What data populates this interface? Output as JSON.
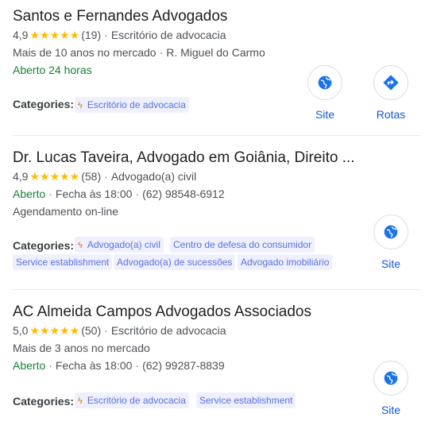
{
  "results": [
    {
      "name": "Santos e Fernandes Advogados",
      "rating": "4,9",
      "stars": "★★★★★",
      "reviews": "(19)",
      "type": "Escritório de advocacia",
      "line2a": "Mais de 10 anos no mercado",
      "line2b": "R. Miguel do Carmo",
      "status": "Aberto 24 horas",
      "categories_label": "Categories:",
      "chips": [
        "Escritório de advocacia"
      ],
      "site_label": "Site",
      "rotas_label": "Rotas"
    },
    {
      "name": "Dr. Lucas Taveira, Advogado em Goiânia, Direito ...",
      "rating": "4,9",
      "stars": "★★★★★",
      "reviews": "(58)",
      "type": "Advogado(a) civil",
      "status": "Aberto",
      "hours": "Fecha às 18:00",
      "phone": "(62) 98548-6912",
      "extra": "Agendamento on-line",
      "categories_label": "Categories:",
      "chips": [
        "Advogado(a) civil",
        "Centro de defesa do consumidor",
        "Service establishment",
        "Advogado(a) de sucessões",
        "Advogado imobiliário"
      ],
      "site_label": "Site"
    },
    {
      "name": "AC Almeida Campos Advogados Associados",
      "rating": "5,0",
      "stars": "★★★★★",
      "reviews": "(50)",
      "type": "Escritório de advocacia",
      "line2a": "Mais de 3 anos no mercado",
      "status": "Aberto",
      "hours": "Fecha às 18:00",
      "phone": "(62) 99287-8839",
      "categories_label": "Categories:",
      "chips": [
        "Escritório de advocacia",
        "Service establishment"
      ],
      "site_label": "Site"
    }
  ],
  "icons": {
    "site": "globe-icon",
    "rotas": "directions-icon",
    "category": "bolt-icon"
  },
  "colors": {
    "star": "#fbbc04",
    "open": "#188038",
    "link": "#1558d6",
    "chip_bg": "#eef1fd",
    "bolt": "#e8710a"
  }
}
